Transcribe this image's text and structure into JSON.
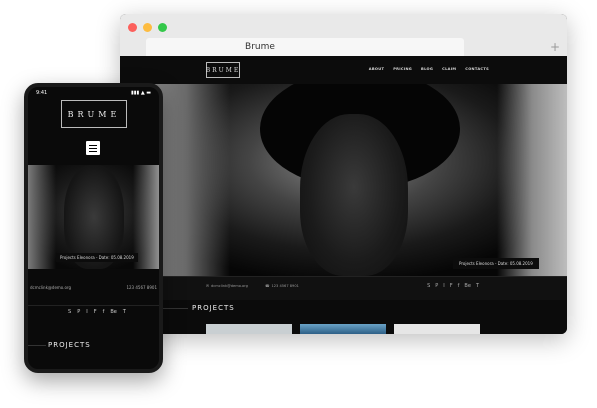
{
  "browser": {
    "tab_title": "Brume",
    "new_tab": "+",
    "lights": [
      "#fc605c",
      "#fdbc40",
      "#34c84a"
    ]
  },
  "site": {
    "logo": "BRUME",
    "nav": [
      "ABOUT",
      "PRICING",
      "BLOG",
      "CLAIM",
      "CONTACTS"
    ],
    "caption": "Projects Eleonora - Date: 05.08.2019",
    "email": "dcmclink@demo.org",
    "phone": "123 4567 8901",
    "socials": [
      "S",
      "P",
      "I",
      "F",
      "f",
      "Be",
      "T"
    ],
    "projects_title": "PROJECTS"
  },
  "phone": {
    "time": "9:41",
    "signal": "▮▮▮ ▲ ▬",
    "logo": "BRUME",
    "caption": "Projects Eleonora - Date: 05.08.2019",
    "email": "dcmclink@demo.org",
    "phone_number": "123 4567 8901",
    "socials": [
      "S",
      "P",
      "I",
      "F",
      "f",
      "Be",
      "T"
    ],
    "projects_title": "PROJECTS"
  }
}
